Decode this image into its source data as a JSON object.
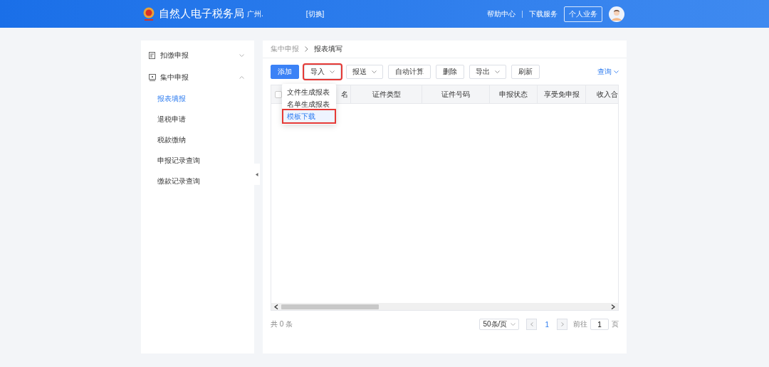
{
  "header": {
    "title": "自然人电子税务局",
    "region": "广州.",
    "switch": "[切换]",
    "links": [
      "帮助中心",
      "下载服务"
    ],
    "account_button": "个人业务"
  },
  "sidebar": {
    "groups": [
      {
        "label": "扣缴申报",
        "expanded": false
      },
      {
        "label": "集中申报",
        "expanded": true,
        "children": [
          {
            "label": "报表填报",
            "selected": true
          },
          {
            "label": "退税申请",
            "selected": false
          },
          {
            "label": "税款缴纳",
            "selected": false
          },
          {
            "label": "申报记录查询",
            "selected": false
          },
          {
            "label": "缴款记录查询",
            "selected": false
          }
        ]
      }
    ]
  },
  "breadcrumb": [
    "集中申报",
    "报表填写"
  ],
  "toolbar": [
    {
      "label": "添加",
      "kind": "primary",
      "highlighted": false
    },
    {
      "label": "导入",
      "kind": "dropdown",
      "highlighted": true
    },
    {
      "label": "报送",
      "kind": "dropdown",
      "highlighted": false
    },
    {
      "label": "自动计算",
      "kind": "plain",
      "highlighted": false
    },
    {
      "label": "删除",
      "kind": "plain",
      "highlighted": false
    },
    {
      "label": "导出",
      "kind": "dropdown",
      "highlighted": false
    },
    {
      "label": "刷新",
      "kind": "plain",
      "highlighted": false
    }
  ],
  "query_link": "查询",
  "import_menu": [
    {
      "label": "文件生成报表",
      "selected": false,
      "highlighted": false
    },
    {
      "label": "名单生成报表",
      "selected": false,
      "highlighted": false
    },
    {
      "label": "模板下载",
      "selected": true,
      "highlighted": true
    }
  ],
  "table": {
    "select_all": {
      "checked": false
    },
    "columns": [
      "名",
      "证件类型",
      "证件号码",
      "申报状态",
      "享受免申报",
      "收入合"
    ]
  },
  "footer": {
    "total": "共 0 条",
    "page_size": "50条/页",
    "current_page": "1",
    "goto_label": "前往",
    "goto_value": "1",
    "page_suffix": "页"
  }
}
